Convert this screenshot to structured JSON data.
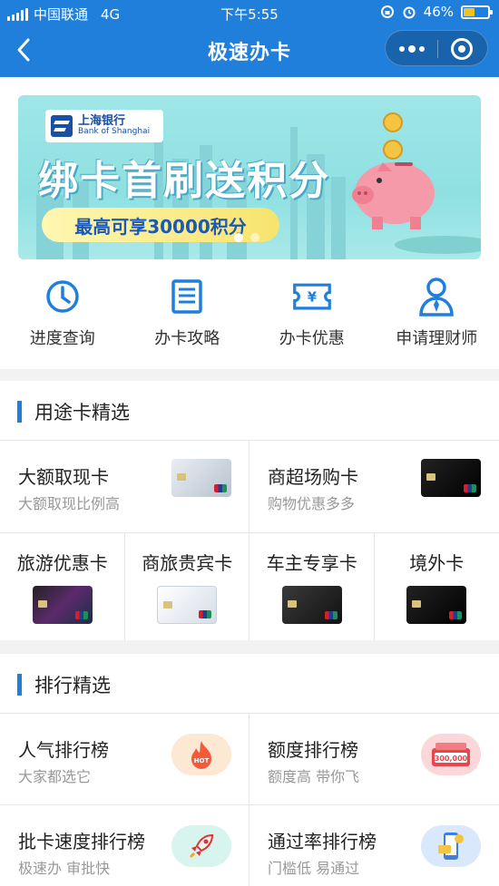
{
  "status": {
    "carrier": "中国联通",
    "network": "4G",
    "time": "下午5:55",
    "battery": "46%",
    "battery_level": 0.46
  },
  "nav": {
    "title": "极速办卡"
  },
  "banner": {
    "bank_cn": "上海银行",
    "bank_en": "Bank of Shanghai",
    "headline": "绑卡首刷送积分",
    "subline": "最高可享30000积分",
    "slide_count": 2,
    "active_slide": 0
  },
  "quick_actions": [
    {
      "label": "进度查询",
      "icon": "clock-icon"
    },
    {
      "label": "办卡攻略",
      "icon": "document-list-icon"
    },
    {
      "label": "办卡优惠",
      "icon": "yen-ticket-icon"
    },
    {
      "label": "申请理财师",
      "icon": "advisor-person-icon"
    }
  ],
  "purpose_section": {
    "title": "用途卡精选",
    "featured": [
      {
        "name": "大额取现卡",
        "desc": "大额取现比例高"
      },
      {
        "name": "商超场购卡",
        "desc": "购物优惠多多"
      }
    ],
    "cards": [
      {
        "name": "旅游优惠卡"
      },
      {
        "name": "商旅贵宾卡"
      },
      {
        "name": "车主专享卡"
      },
      {
        "name": "境外卡"
      }
    ]
  },
  "ranking_section": {
    "title": "排行精选",
    "items": [
      {
        "name": "人气排行榜",
        "desc": "大家都选它",
        "icon": "fire-hot-icon"
      },
      {
        "name": "额度排行榜",
        "desc": "额度高 带你飞",
        "icon": "credit-amount-icon",
        "amount_text": "300,000"
      },
      {
        "name": "批卡速度排行榜",
        "desc": "极速办 审批快",
        "icon": "rocket-icon"
      },
      {
        "name": "通过率排行榜",
        "desc": "门槛低 易通过",
        "icon": "phone-card-icon"
      }
    ]
  },
  "colors": {
    "brand_blue": "#1f7fdb",
    "page_bg": "#f2f2f2"
  }
}
